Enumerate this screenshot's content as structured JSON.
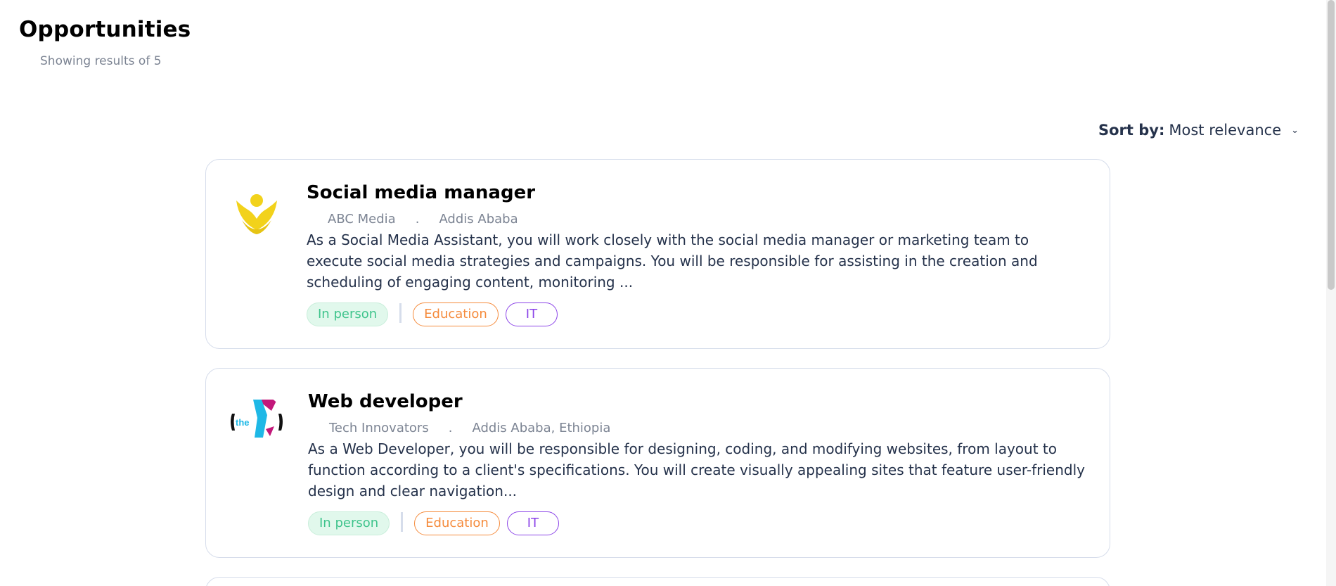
{
  "header": {
    "title": "Opportunities",
    "results_text": "Showing results of 5"
  },
  "sort": {
    "label": "Sort by:",
    "value": "Most relevance"
  },
  "jobs": [
    {
      "title": "Social media manager",
      "company": "ABC Media",
      "separator": ".",
      "location": "Addis Ababa",
      "description": "As a Social Media Assistant, you will work closely with the social media manager or marketing team to execute social media strategies and campaigns. You will be responsible for assisting in the creation and scheduling of engaging content, monitoring ...",
      "tags": [
        "In person",
        "Education",
        "IT"
      ]
    },
    {
      "title": "Web developer",
      "company": "Tech Innovators",
      "separator": ".",
      "location": "Addis Ababa, Ethiopia",
      "description": "As a Web Developer, you will be responsible for designing, coding, and modifying websites, from layout to function according to a client's specifications. You will create visually appealing sites that feature user-friendly design and clear navigation...",
      "tags": [
        "In person",
        "Education",
        "IT"
      ],
      "logo_text": "the"
    }
  ],
  "colors": {
    "tag_in_person": "#3FC48C",
    "tag_education": "#F58B3C",
    "tag_it": "#8C45E8",
    "logo_yellow": "#F2D21B",
    "logo_cyan": "#1EB8E6",
    "logo_magenta": "#C2187A"
  }
}
